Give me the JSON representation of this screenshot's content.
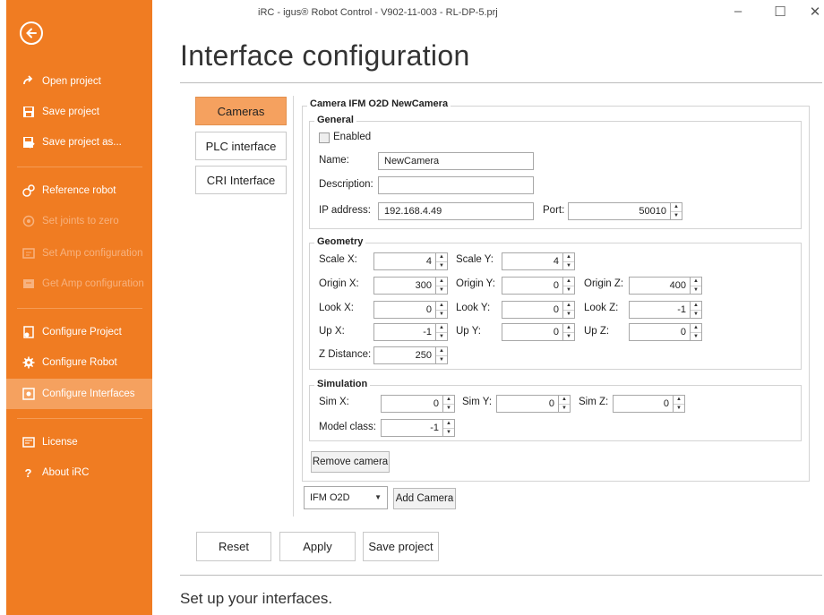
{
  "window": {
    "title": "iRC - igus® Robot Control - V902-11-003 - RL-DP-5.prj",
    "minimize": "–",
    "maximize": "☐",
    "close": "✕"
  },
  "sidebar": {
    "items": [
      {
        "label": "Open project",
        "icon": "open-project-icon",
        "enabled": true
      },
      {
        "label": "Save project",
        "icon": "save-icon",
        "enabled": true
      },
      {
        "label": "Save project as...",
        "icon": "save-as-icon",
        "enabled": true
      },
      {
        "label": "Reference robot",
        "icon": "reference-robot-icon",
        "enabled": true
      },
      {
        "label": "Set joints to zero",
        "icon": "set-joints-zero-icon",
        "enabled": false
      },
      {
        "label": "Set Amp configuration",
        "icon": "set-amp-config-icon",
        "enabled": false
      },
      {
        "label": "Get Amp configuration",
        "icon": "get-amp-config-icon",
        "enabled": false
      },
      {
        "label": "Configure Project",
        "icon": "configure-project-icon",
        "enabled": true
      },
      {
        "label": "Configure Robot",
        "icon": "gear-icon",
        "enabled": true
      },
      {
        "label": "Configure Interfaces",
        "icon": "configure-interfaces-icon",
        "enabled": true,
        "active": true
      },
      {
        "label": "License",
        "icon": "license-icon",
        "enabled": true
      },
      {
        "label": "About iRC",
        "icon": "question-icon",
        "enabled": true
      }
    ]
  },
  "page": {
    "title": "Interface configuration",
    "footer": "Set up your interfaces."
  },
  "tabs": [
    {
      "label": "Cameras",
      "active": true
    },
    {
      "label": "PLC interface",
      "active": false
    },
    {
      "label": "CRI Interface",
      "active": false
    }
  ],
  "camera": {
    "title": "Camera IFM O2D NewCamera",
    "general": {
      "title": "General",
      "enabled_label": "Enabled",
      "name_label": "Name:",
      "name_value": "NewCamera",
      "description_label": "Description:",
      "description_value": "",
      "ip_label": "IP address:",
      "ip_value": "192.168.4.49",
      "port_label": "Port:",
      "port_value": "50010"
    },
    "geometry": {
      "title": "Geometry",
      "scale_x_label": "Scale X:",
      "scale_x": "4",
      "scale_y_label": "Scale Y:",
      "scale_y": "4",
      "origin_x_label": "Origin X:",
      "origin_x": "300",
      "origin_y_label": "Origin Y:",
      "origin_y": "0",
      "origin_z_label": "Origin Z:",
      "origin_z": "400",
      "look_x_label": "Look X:",
      "look_x": "0",
      "look_y_label": "Look Y:",
      "look_y": "0",
      "look_z_label": "Look Z:",
      "look_z": "-1",
      "up_x_label": "Up X:",
      "up_x": "-1",
      "up_y_label": "Up Y:",
      "up_y": "0",
      "up_z_label": "Up Z:",
      "up_z": "0",
      "z_distance_label": "Z Distance:",
      "z_distance": "250"
    },
    "simulation": {
      "title": "Simulation",
      "sim_x_label": "Sim X:",
      "sim_x": "0",
      "sim_y_label": "Sim Y:",
      "sim_y": "0",
      "sim_z_label": "Sim Z:",
      "sim_z": "0",
      "model_class_label": "Model class:",
      "model_class": "-1"
    },
    "remove_label": "Remove camera",
    "camera_type_selected": "IFM O2D",
    "add_label": "Add Camera"
  },
  "actions": {
    "reset": "Reset",
    "apply": "Apply",
    "save": "Save project"
  },
  "colors": {
    "sidebar": "#f07c22",
    "active": "#f5a15f"
  }
}
